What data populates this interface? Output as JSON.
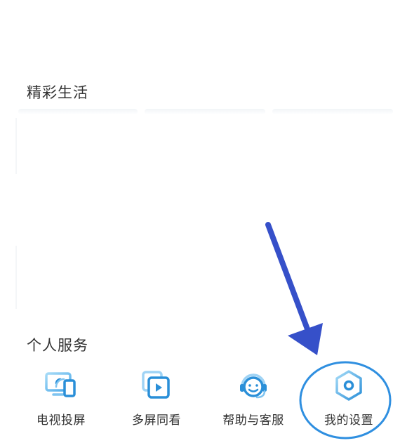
{
  "sections": {
    "life_title": "精彩生活",
    "service_title": "个人服务"
  },
  "services": [
    {
      "label": "电视投屏",
      "icon": "tv-cast-icon"
    },
    {
      "label": "多屏同看",
      "icon": "multi-screen-icon"
    },
    {
      "label": "帮助与客服",
      "icon": "customer-service-icon"
    },
    {
      "label": "我的设置",
      "icon": "settings-icon"
    }
  ],
  "colors": {
    "accent": "#2a8fd8",
    "accent_light": "#9fd3f5",
    "annotation_arrow": "#3650c9",
    "annotation_circle": "#2f8fe0"
  }
}
